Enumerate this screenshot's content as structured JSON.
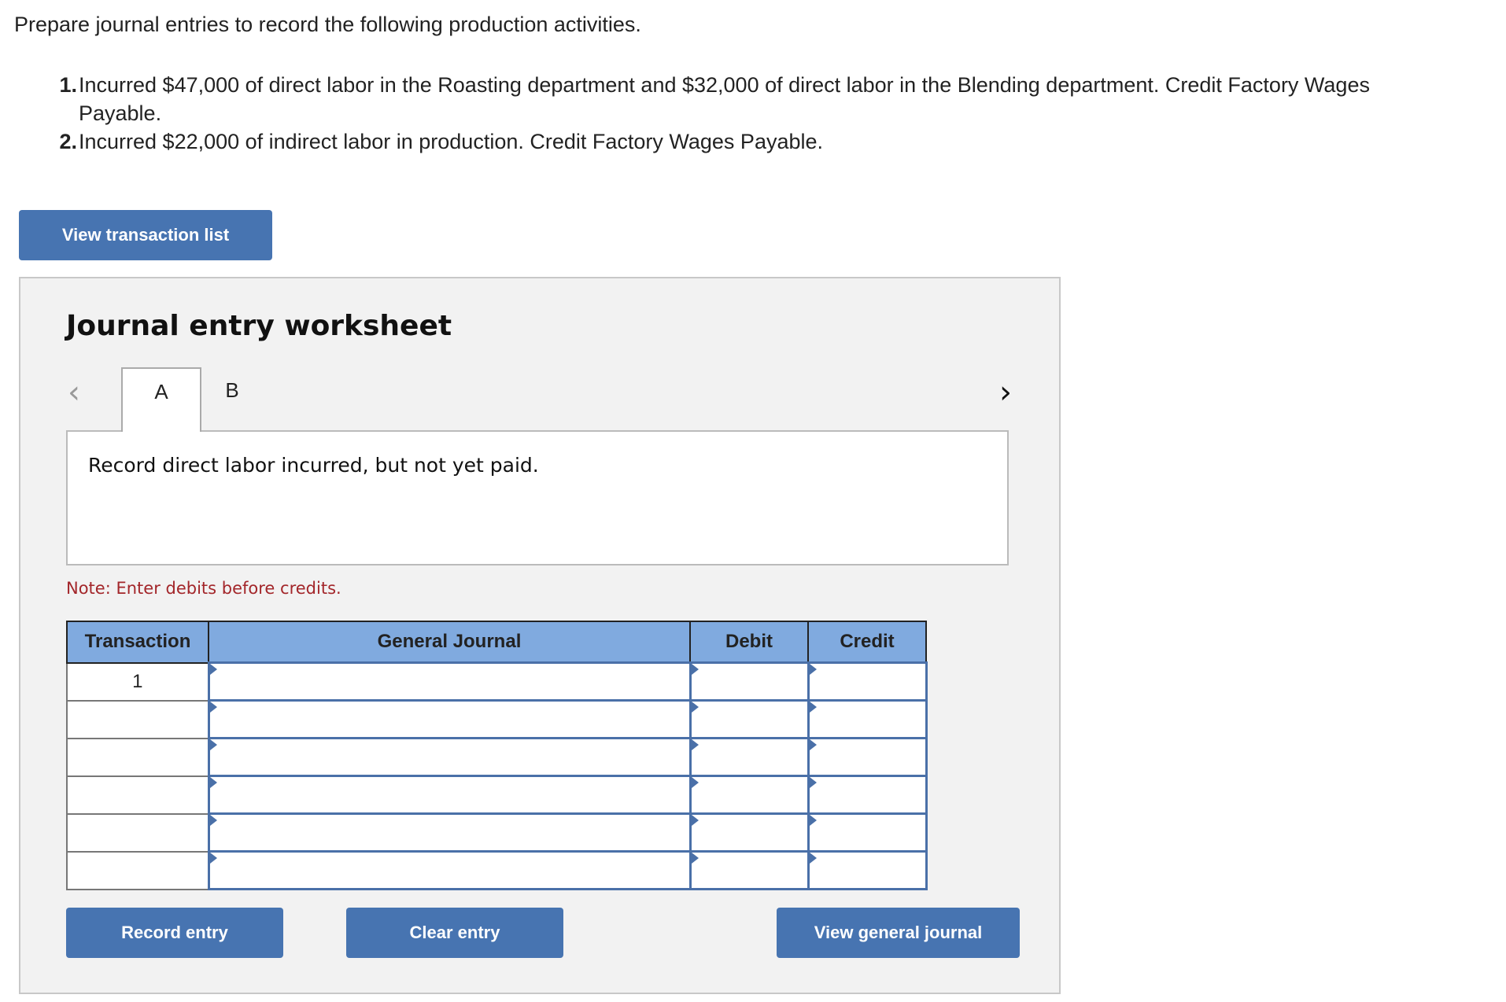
{
  "instructions": {
    "intro": "Prepare journal entries to record the following production activities.",
    "items": [
      {
        "number": "1.",
        "text": "Incurred $47,000 of direct labor in the Roasting department and $32,000 of direct labor in the Blending department. Credit Factory Wages Payable."
      },
      {
        "number": "2.",
        "text": "Incurred $22,000 of indirect labor in production. Credit Factory Wages Payable."
      }
    ]
  },
  "view_transaction_list_label": "View transaction list",
  "worksheet": {
    "title": "Journal entry worksheet",
    "tabs": [
      {
        "label": "A",
        "active": true
      },
      {
        "label": "B",
        "active": false
      }
    ],
    "prev_icon": "chevron-left-icon",
    "next_icon": "chevron-right-icon",
    "description": "Record direct labor incurred, but not yet paid.",
    "note": "Note: Enter debits before credits.",
    "table": {
      "headers": [
        "Transaction",
        "General Journal",
        "Debit",
        "Credit"
      ],
      "rows": [
        {
          "transaction": "1",
          "account": "",
          "debit": "",
          "credit": ""
        },
        {
          "transaction": "",
          "account": "",
          "debit": "",
          "credit": ""
        },
        {
          "transaction": "",
          "account": "",
          "debit": "",
          "credit": ""
        },
        {
          "transaction": "",
          "account": "",
          "debit": "",
          "credit": ""
        },
        {
          "transaction": "",
          "account": "",
          "debit": "",
          "credit": ""
        },
        {
          "transaction": "",
          "account": "",
          "debit": "",
          "credit": ""
        }
      ]
    },
    "buttons": {
      "record": "Record entry",
      "clear": "Clear entry",
      "view_journal": "View general journal"
    }
  },
  "colors": {
    "button": "#4774b1",
    "header": "#80aadf",
    "note": "#a3262a"
  }
}
